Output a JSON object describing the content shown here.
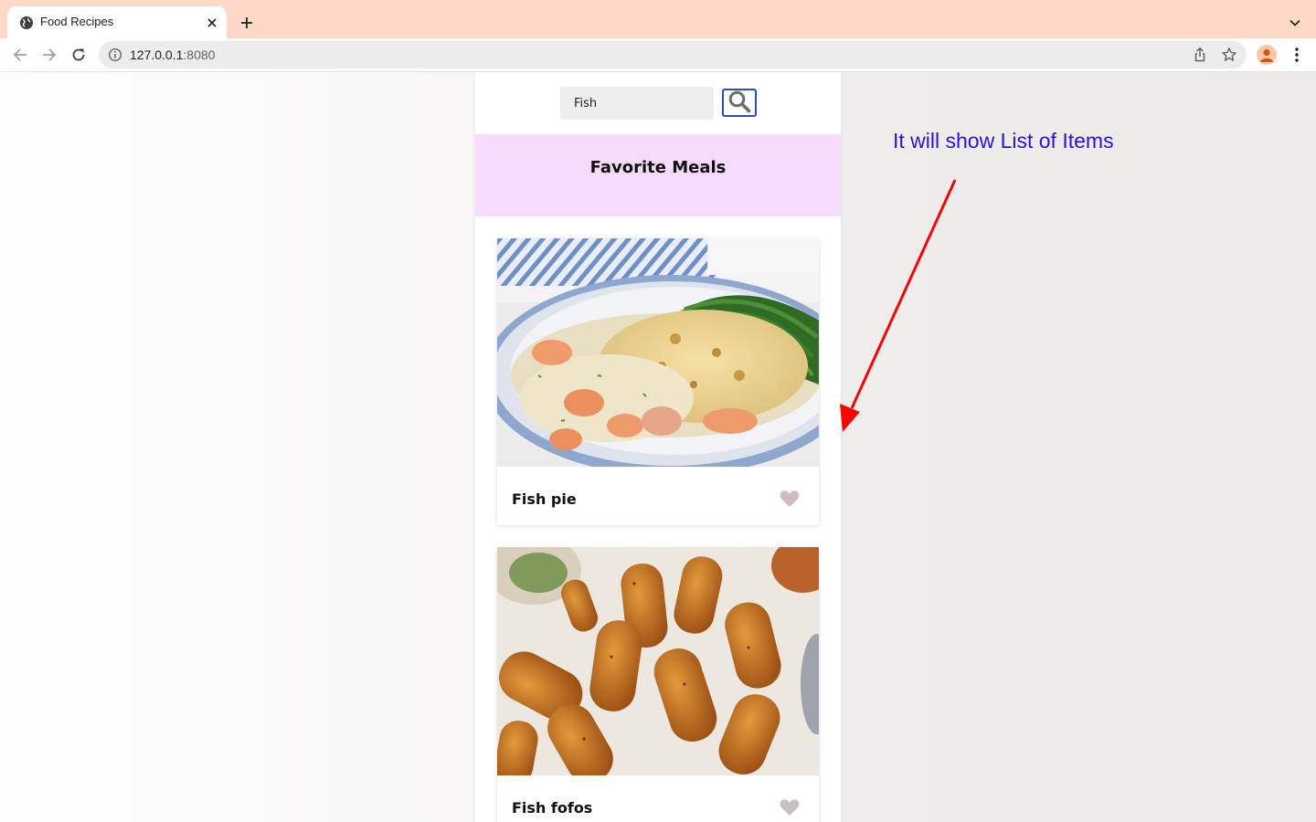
{
  "browser": {
    "tab_title": "Food Recipes",
    "url_host": "127.0.0.1",
    "url_port": ":8080",
    "icons": {
      "favicon": "globe-icon",
      "close": "close-icon",
      "new_tab": "plus-icon",
      "tab_menu": "chevron-down-icon",
      "back": "arrow-left-icon",
      "forward": "arrow-right-icon",
      "reload": "reload-icon",
      "info": "info-icon",
      "share": "share-icon",
      "bookmark": "star-icon",
      "profile": "avatar",
      "menu": "kebab-icon"
    },
    "colors": {
      "tabstrip": "#ffd9c7"
    }
  },
  "app": {
    "search": {
      "value": "Fish",
      "icon": "search-icon"
    },
    "favorites": {
      "title": "Favorite Meals"
    },
    "meals": [
      {
        "name": "Fish pie",
        "favorite_icon": "heart-icon"
      },
      {
        "name": "Fish fofos",
        "favorite_icon": "heart-icon"
      }
    ],
    "colors": {
      "favorites_panel": "#f4dafd",
      "search_button_border": "#2a4fb0",
      "heart": "#c9bfbf"
    }
  },
  "annotation": {
    "text": "It will show List of Items",
    "color": "#2a12e0",
    "arrow_color": "#ff0000"
  }
}
